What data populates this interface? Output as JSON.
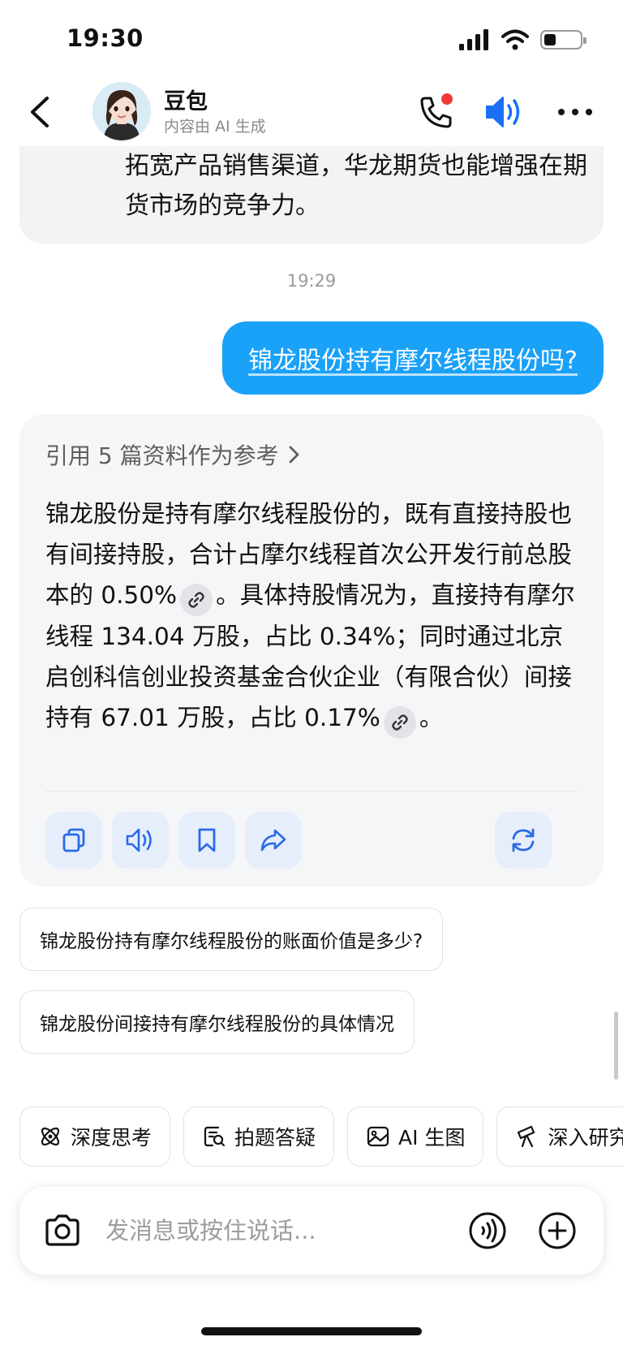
{
  "status_bar": {
    "time": "19:30",
    "battery_level": 0.25
  },
  "header": {
    "name": "豆包",
    "subtitle": "内容由 AI 生成",
    "icons": [
      "back-arrow-icon",
      "phone-icon",
      "speaker-icon",
      "more-icon"
    ],
    "accent_color": "#1a6ff5",
    "notification_color": "#f03a3a"
  },
  "chat": {
    "prev_message": "拓宽产品销售渠道，华龙期货也能增强在期货市场的竞争力。",
    "timestamp": "19:29",
    "user_message": "锦龙股份持有摩尔线程股份吗?",
    "user_bubble_color": "#1aa1f8",
    "bot": {
      "citation": "引用 5 篇资料作为参考",
      "answer_part1": "锦龙股份是持有摩尔线程股份的，既有直接持股也有间接持股，合计占摩尔线程首次公开发行前总股本的 0.50%",
      "answer_part2": "。具体持股情况为，直接持有摩尔线程 134.04 万股，占比 0.34%；同时通过北京启创科信创业投资基金合伙企业（有限合伙）间接持有 67.01 万股，占比 0.17%",
      "answer_part3": "。",
      "actions": [
        "copy-icon",
        "read-aloud-icon",
        "bookmark-icon",
        "share-icon",
        "regenerate-icon"
      ]
    }
  },
  "suggestions": [
    "锦龙股份持有摩尔线程股份的账面价值是多少?",
    "锦龙股份间接持有摩尔线程股份的具体情况"
  ],
  "tools": [
    {
      "label": "深度思考",
      "icon": "atom-icon"
    },
    {
      "label": "拍题答疑",
      "icon": "scan-question-icon"
    },
    {
      "label": "AI 生图",
      "icon": "image-icon"
    },
    {
      "label": "深入研究",
      "icon": "telescope-icon"
    }
  ],
  "input": {
    "placeholder": "发消息或按住说话..."
  }
}
